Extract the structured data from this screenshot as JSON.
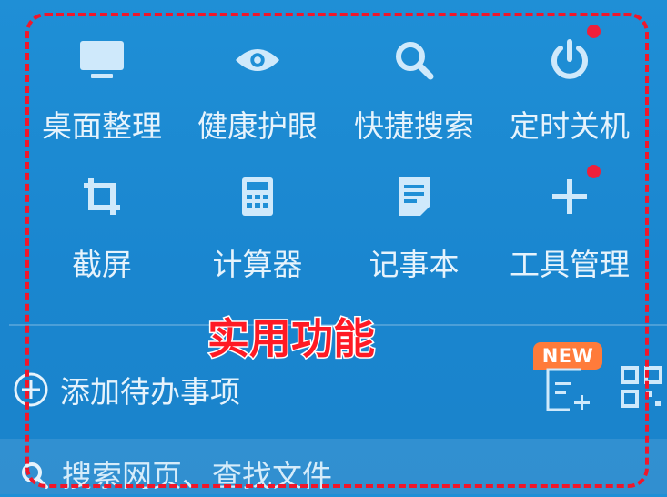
{
  "tools": [
    {
      "label": "桌面整理",
      "icon": "monitor-icon",
      "badge": false
    },
    {
      "label": "健康护眼",
      "icon": "eye-icon",
      "badge": false
    },
    {
      "label": "快捷搜索",
      "icon": "search-icon",
      "badge": false
    },
    {
      "label": "定时关机",
      "icon": "power-icon",
      "badge": true
    },
    {
      "label": "截屏",
      "icon": "crop-icon",
      "badge": false
    },
    {
      "label": "计算器",
      "icon": "calculator-icon",
      "badge": false
    },
    {
      "label": "记事本",
      "icon": "notepad-icon",
      "badge": false
    },
    {
      "label": "工具管理",
      "icon": "plus-icon",
      "badge": true
    }
  ],
  "annotation": {
    "text": "实用功能"
  },
  "todo": {
    "label": "添加待办事项",
    "icon": "add-circle-icon"
  },
  "new_tag": {
    "text": "NEW"
  },
  "search": {
    "placeholder": "搜索网页、查找文件",
    "icon": "search-icon"
  },
  "colors": {
    "background": "#1f8fd6",
    "icon": "#cfe9fb",
    "badge": "#ef1f3a",
    "annotation": "#ff1a24",
    "new_tag": "#ff7b3a"
  }
}
